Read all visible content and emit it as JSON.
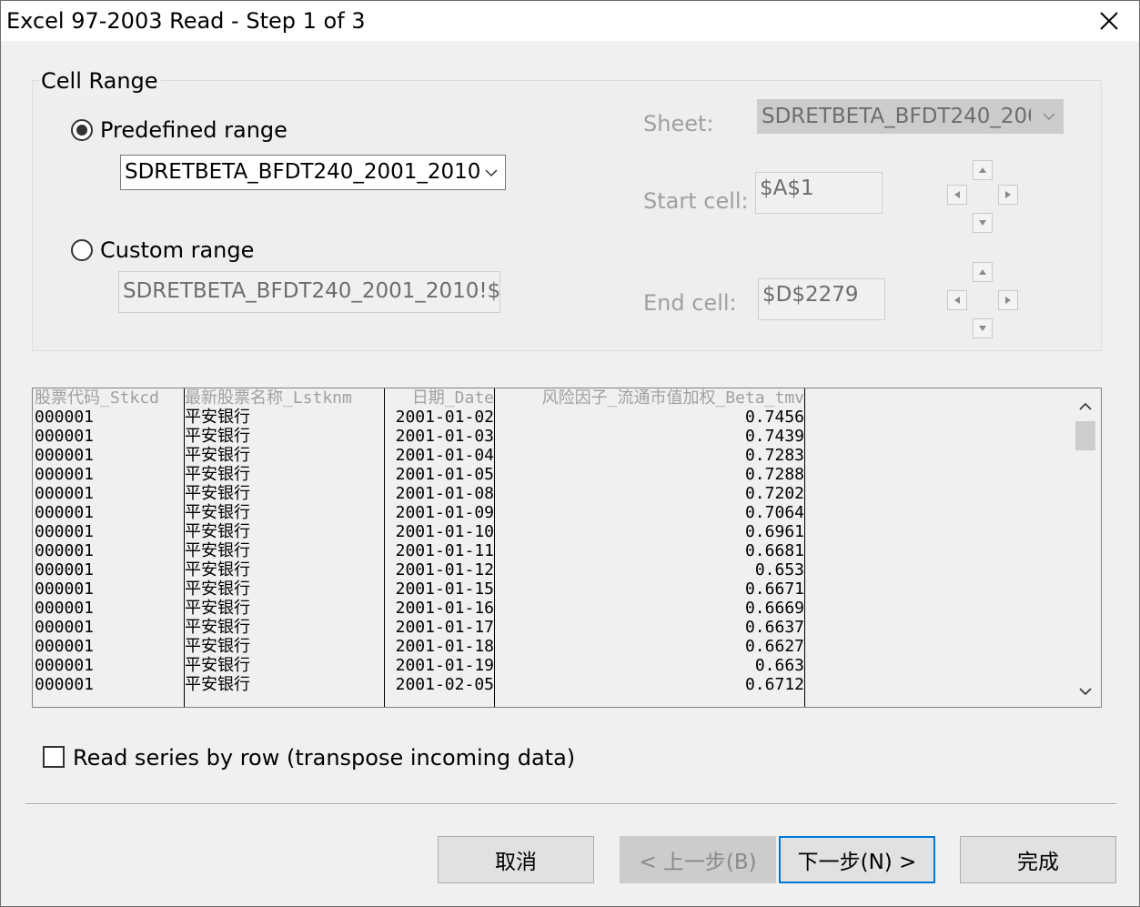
{
  "window": {
    "title": "Excel 97-2003 Read - Step 1 of 3"
  },
  "cell_range": {
    "group_label": "Cell Range",
    "predefined": {
      "label": "Predefined range",
      "selected": true,
      "value": "SDRETBETA_BFDT240_2001_2010"
    },
    "custom": {
      "label": "Custom range",
      "selected": false,
      "value": "SDRETBETA_BFDT240_2001_2010!$A"
    },
    "sheet": {
      "label": "Sheet:",
      "value": "SDRETBETA_BFDT240_200"
    },
    "start_cell": {
      "label": "Start cell:",
      "value": "$A$1"
    },
    "end_cell": {
      "label": "End cell:",
      "value": "$D$2279"
    }
  },
  "preview": {
    "columns": [
      "股票代码_Stkcd",
      "最新股票名称_Lstknm",
      "日期_Date",
      "风险因子_流通市值加权_Beta_tmv"
    ],
    "rows": [
      [
        "000001",
        "平安银行",
        "2001-01-02",
        "0.7456"
      ],
      [
        "000001",
        "平安银行",
        "2001-01-03",
        "0.7439"
      ],
      [
        "000001",
        "平安银行",
        "2001-01-04",
        "0.7283"
      ],
      [
        "000001",
        "平安银行",
        "2001-01-05",
        "0.7288"
      ],
      [
        "000001",
        "平安银行",
        "2001-01-08",
        "0.7202"
      ],
      [
        "000001",
        "平安银行",
        "2001-01-09",
        "0.7064"
      ],
      [
        "000001",
        "平安银行",
        "2001-01-10",
        "0.6961"
      ],
      [
        "000001",
        "平安银行",
        "2001-01-11",
        "0.6681"
      ],
      [
        "000001",
        "平安银行",
        "2001-01-12",
        "0.653"
      ],
      [
        "000001",
        "平安银行",
        "2001-01-15",
        "0.6671"
      ],
      [
        "000001",
        "平安银行",
        "2001-01-16",
        "0.6669"
      ],
      [
        "000001",
        "平安银行",
        "2001-01-17",
        "0.6637"
      ],
      [
        "000001",
        "平安银行",
        "2001-01-18",
        "0.6627"
      ],
      [
        "000001",
        "平安银行",
        "2001-01-19",
        "0.663"
      ],
      [
        "000001",
        "平安银行",
        "2001-02-05",
        "0.6712"
      ]
    ]
  },
  "transpose": {
    "label": "Read series by row (transpose incoming data)",
    "checked": false
  },
  "buttons": {
    "cancel": "取消",
    "back": "< 上一步(B)",
    "next": "下一步(N) >",
    "finish": "完成"
  },
  "icons": {
    "close": "close-icon",
    "dropdown": "chevron-down-icon",
    "scroll_up": "chevron-up-icon",
    "scroll_down": "chevron-down-icon"
  }
}
